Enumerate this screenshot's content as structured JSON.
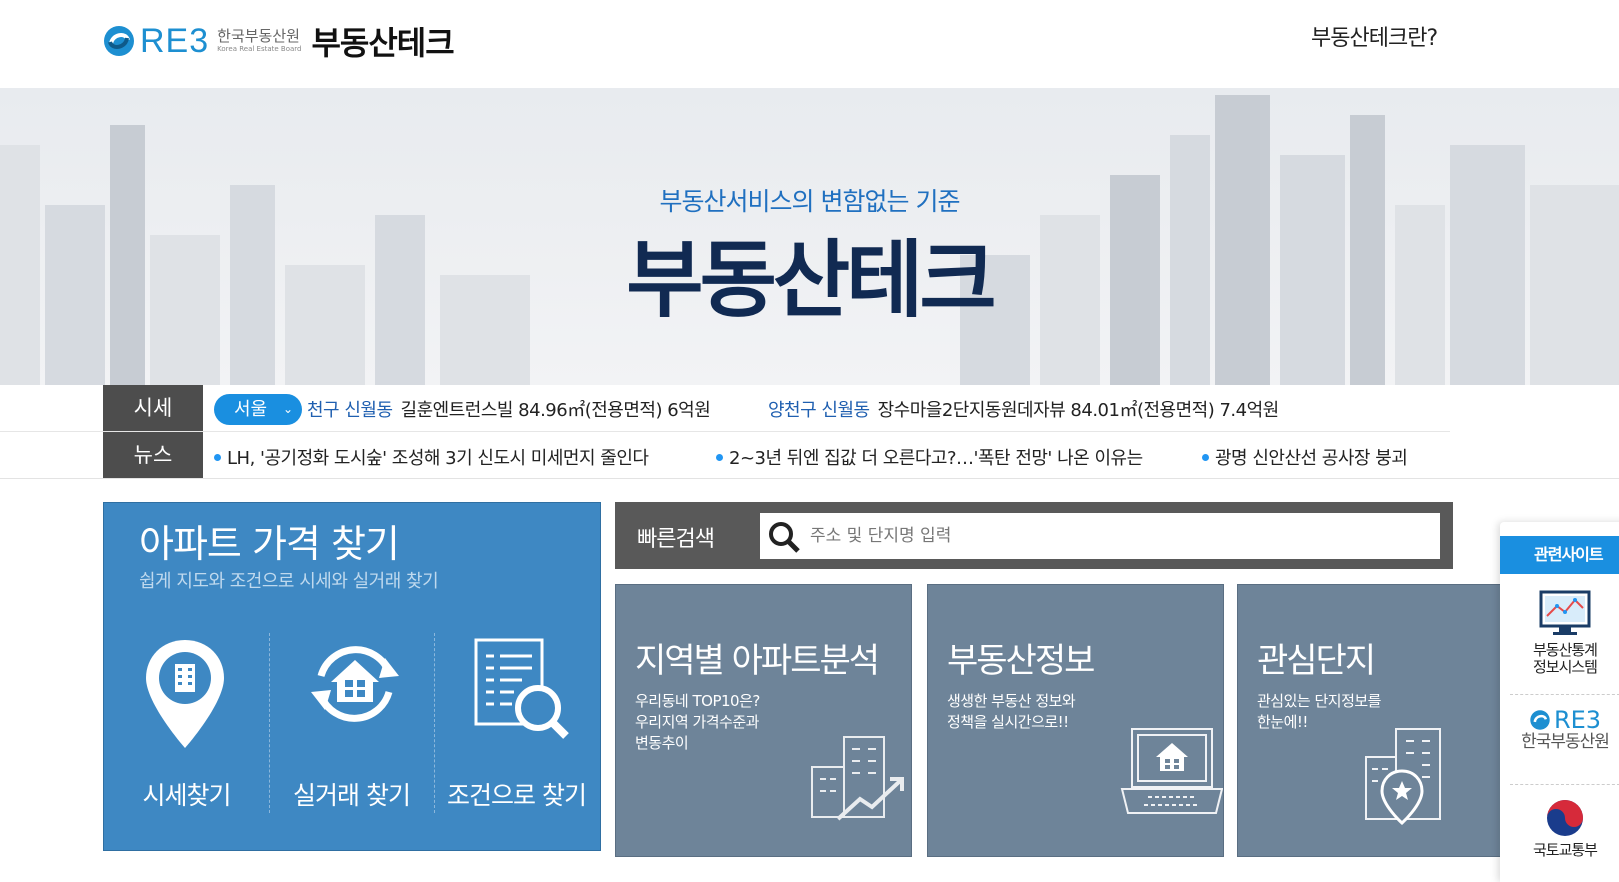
{
  "header": {
    "logo_mark": "RE3",
    "org_name_kr": "한국부동산원",
    "org_name_en": "Korea Real Estate Board",
    "service_name": "부동산테크",
    "about_link": "부동산테크란?"
  },
  "hero": {
    "subtitle": "부동산서비스의 변함없는 기준",
    "title": "부동산테크"
  },
  "ticker": {
    "price_label": "시세",
    "news_label": "뉴스",
    "region_selected": "서울",
    "prices": [
      {
        "district": "천구 신월동",
        "text": "길훈엔트런스빌  84.96㎡(전용면적)  6억원"
      },
      {
        "district": "양천구 신월동",
        "text": "장수마을2단지동원데자뷰  84.01㎡(전용면적)  7.4억원"
      }
    ],
    "news": [
      "LH, '공기정화 도시숲' 조성해 3기 신도시 미세먼지 줄인다",
      "2~3년 뒤엔 집값 더 오른다고?…'폭탄 전망' 나온 이유는",
      "광명 신안산선 공사장 붕괴"
    ]
  },
  "apt_panel": {
    "title": "아파트 가격 찾기",
    "subtitle": "쉽게 지도와 조건으로 시세와 실거래 찾기",
    "buttons": [
      {
        "label": "시세찾기",
        "icon": "map-pin-building-icon"
      },
      {
        "label": "실거래 찾기",
        "icon": "house-cycle-icon"
      },
      {
        "label": "조건으로 찾기",
        "icon": "document-search-icon"
      }
    ]
  },
  "search": {
    "label": "빠른검색",
    "placeholder": "주소 및 단지명 입력",
    "icon": "search-icon"
  },
  "tiles": [
    {
      "title": "지역별 아파트분석",
      "desc": [
        "우리동네 TOP10은?",
        "우리지역 가격수준과",
        "변동추이"
      ],
      "icon": "building-chart-icon"
    },
    {
      "title": "부동산정보",
      "desc": [
        "생생한 부동산 정보와",
        "정책을 실시간으로!!"
      ],
      "icon": "laptop-house-icon"
    },
    {
      "title": "관심단지",
      "desc": [
        "관심있는 단지정보를",
        "한눈에!!"
      ],
      "icon": "building-pin-icon"
    }
  ],
  "related": {
    "title": "관련사이트",
    "items": [
      {
        "lines": [
          "부동산통계",
          "정보시스템"
        ],
        "icon": "monitor-chart-icon"
      },
      {
        "lines": [
          "한국부동산원"
        ],
        "logo": "RE3"
      },
      {
        "lines": [
          "국토교통부"
        ],
        "icon": "taeguk-icon"
      }
    ]
  },
  "colors": {
    "brand_blue": "#1a8fe0",
    "panel_blue": "#3e88c3",
    "tile_gray": "#6e8499",
    "dark_label": "#4d4d4d",
    "hero_title": "#112a52"
  }
}
